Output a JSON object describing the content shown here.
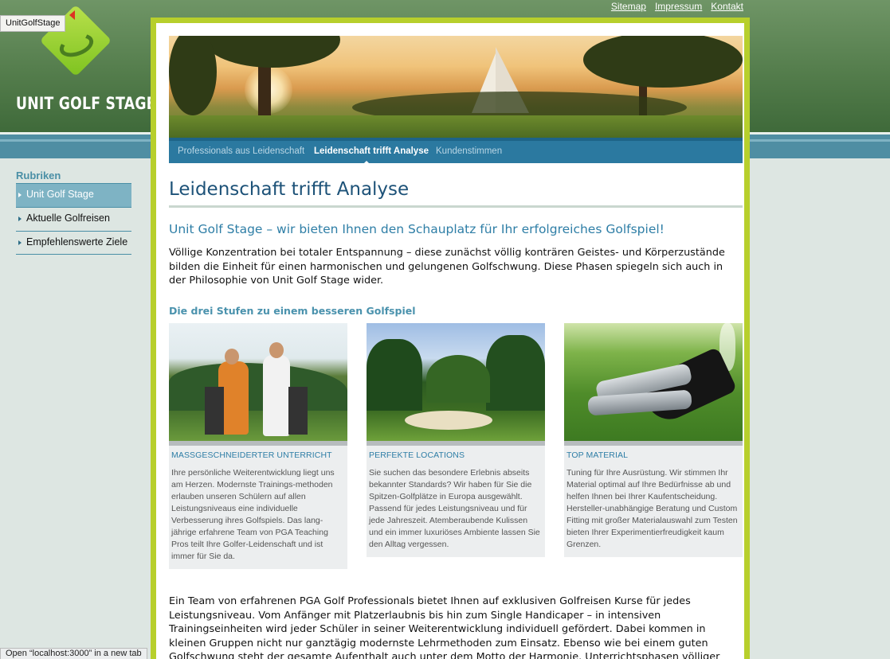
{
  "tooltip": {
    "text": "UnitGolfStage"
  },
  "logo": {
    "text": "UNIT GOLF STAGE"
  },
  "top_links": [
    "Sitemap",
    "Impressum",
    "Kontakt"
  ],
  "sidebar": {
    "title": "Rubriken",
    "items": [
      {
        "label": "Unit Golf Stage",
        "active": true
      },
      {
        "label": "Aktuelle Golfreisen",
        "active": false
      },
      {
        "label": "Empfehlenswerte Ziele",
        "active": false
      }
    ]
  },
  "nav": {
    "items": [
      {
        "label": "Professionals aus Leidenschaft",
        "active": false
      },
      {
        "label": "Leidenschaft trifft Analyse",
        "active": true
      },
      {
        "label": "Kundenstimmen",
        "active": false
      }
    ]
  },
  "main": {
    "title": "Leidenschaft trifft Analyse",
    "subtitle": "Unit Golf Stage – wir bieten Ihnen den Schauplatz für Ihr erfolgreiches Golfspiel!",
    "intro": "Völlige Konzentration bei totaler Entspannung – diese zunächst völlig konträren Geistes- und Körperzustände bilden die Einheit für einen harmonischen und gelungenen Golfschwung. Diese Phasen spiegeln sich auch in der Philosophie von Unit Golf Stage wider.",
    "section_heading": "Die drei Stufen zu einem besseren Golfspiel",
    "cards": [
      {
        "title": "Massgeschneiderter Unterricht",
        "text": "Ihre persönliche Weiterentwicklung liegt uns am Herzen. Modernste Trainings-methoden erlauben unseren Schülern auf allen Leistungsniveaus eine individuelle Verbesserung ihres Golfspiels. Das lang-jährige erfahrene Team von PGA Teaching Pros teilt Ihre Golfer-Leidenschaft und ist immer für Sie da."
      },
      {
        "title": "Perfekte Locations",
        "text": "Sie suchen das besondere Erlebnis abseits bekannter Standards? Wir haben für Sie die Spitzen-Golfplätze in Europa ausgewählt. Passend für jedes Leistungsniveau und für jede Jahreszeit. Atemberaubende Kulissen und ein immer luxuriöses Ambiente lassen Sie den Alltag vergessen."
      },
      {
        "title": "Top Material",
        "text": "Tuning für Ihre Ausrüstung. Wir stimmen Ihr Material optimal auf Ihre Bedürfnisse ab und helfen Ihnen bei Ihrer Kaufentscheidung. Hersteller-unabhängige Beratung und Custom Fitting mit großer Materialauswahl zum Testen bieten Ihrer Experimentierfreudigkeit kaum Grenzen."
      }
    ],
    "outro": "Ein Team von erfahrenen PGA Golf Professionals bietet Ihnen auf exklusiven Golfreisen Kurse für jedes Leistungsniveau. Vom Anfänger mit Platzerlaubnis bis hin zum Single Handicaper – in intensiven Trainingseinheiten wird jeder Schüler in seiner Weiterentwicklung individuell gefördert. Dabei kommen in kleinen Gruppen nicht nur ganztägig modernste Lehrmethoden zum Einsatz. Ebenso wie bei einem guten Golfschwung steht der gesamte Aufenthalt auch unter dem Motto der Harmonie. Unterrichtsphasen völliger Konzentration verlangen nach Entspannung und dem Ausklang eines gelungenen"
  },
  "status_bar": {
    "text": "Open “localhost:3000” in a new tab"
  },
  "colors": {
    "accent_green": "#b7cf2c",
    "nav_blue": "#2b79a0",
    "heading_blue": "#1d5278",
    "sidebar_active": "#7eb3c4"
  }
}
